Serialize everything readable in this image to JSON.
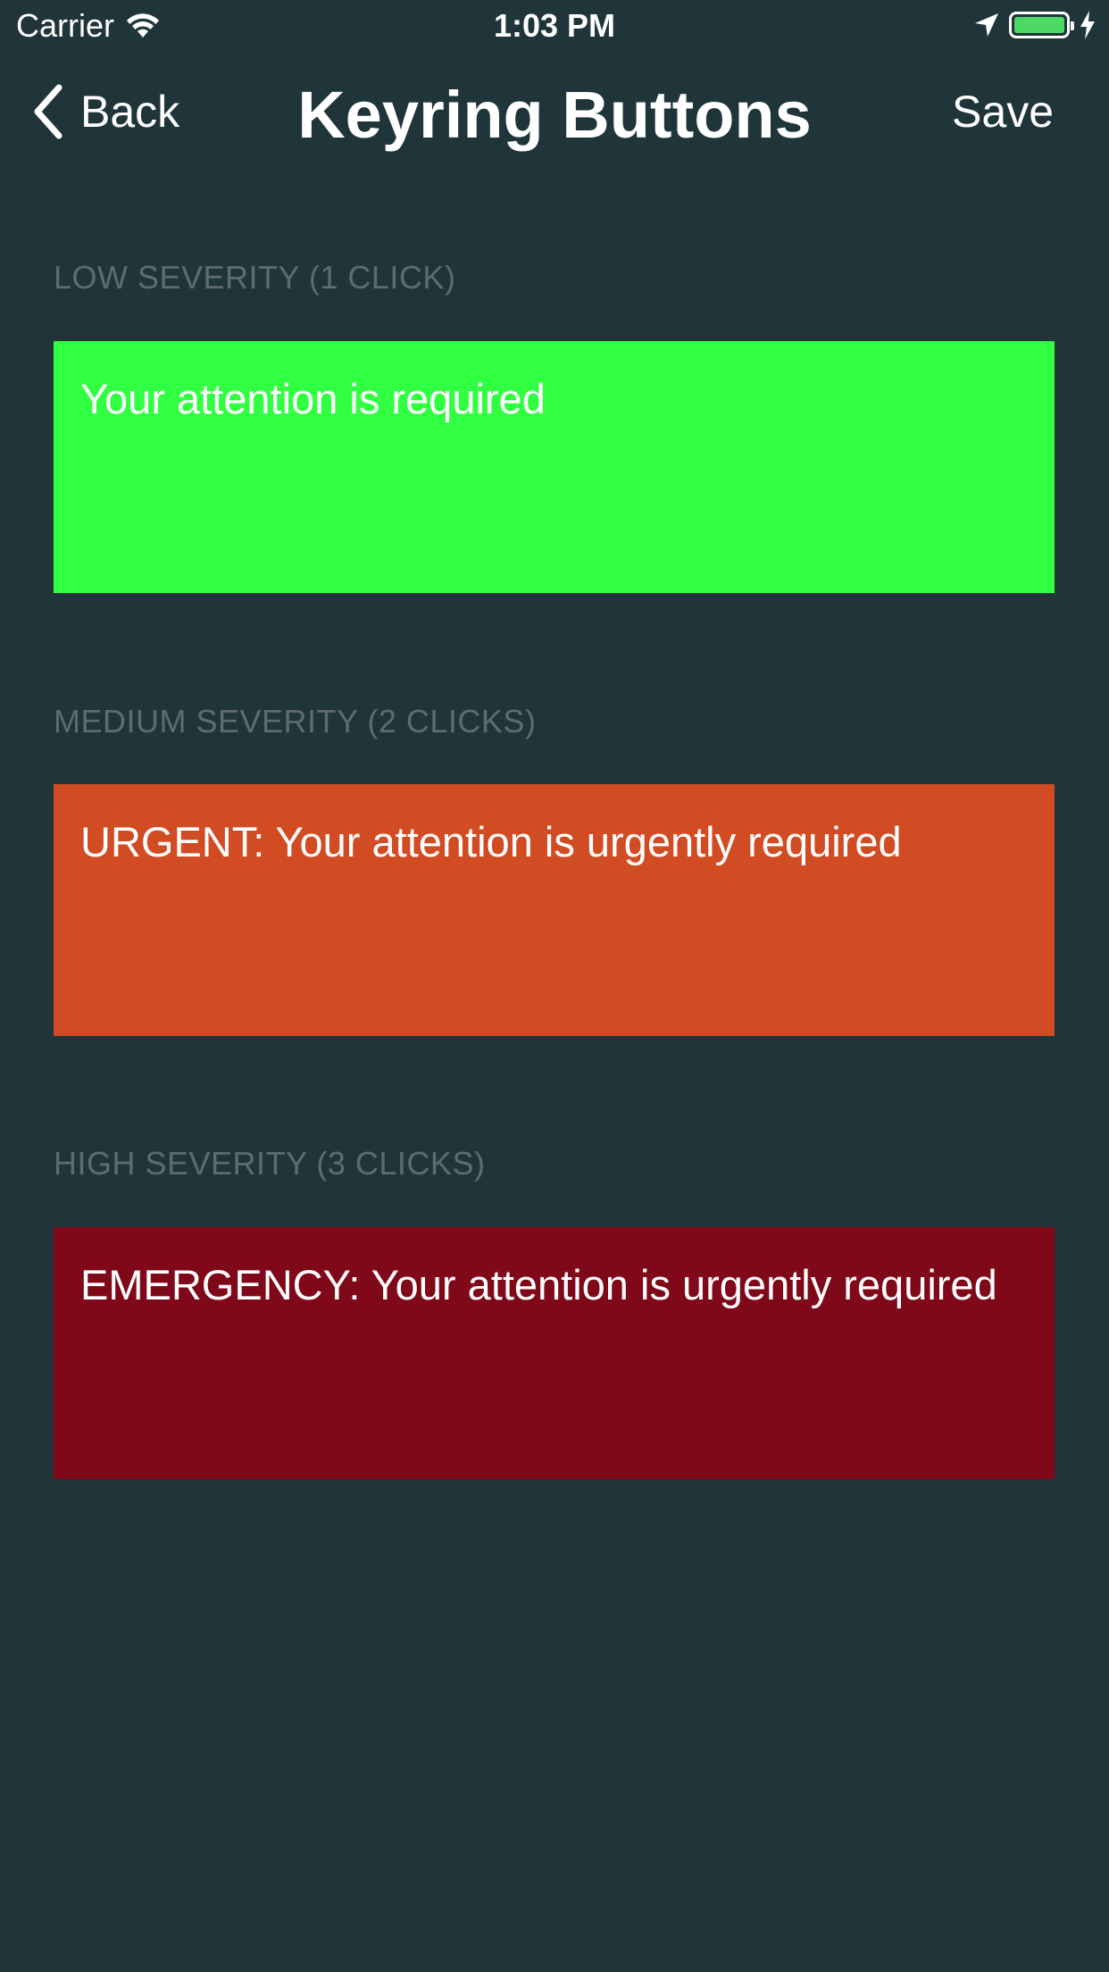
{
  "status_bar": {
    "carrier": "Carrier",
    "time": "1:03 PM",
    "battery_color": "#4cd964"
  },
  "nav": {
    "back_label": "Back",
    "title": "Keyring Buttons",
    "save_label": "Save"
  },
  "sections": [
    {
      "header": "LOW SEVERITY (1 CLICK)",
      "message": "Your attention is required",
      "color": "#31ff42"
    },
    {
      "header": "MEDIUM SEVERITY (2 CLICKS)",
      "message": "URGENT: Your attention is urgently required",
      "color": "#d14b23"
    },
    {
      "header": "HIGH SEVERITY (3 CLICKS)",
      "message": "EMERGENCY: Your attention is urgently required",
      "color": "#7f0819"
    }
  ],
  "theme": {
    "background": "#20353a",
    "section_header_color": "#5f6b71"
  }
}
